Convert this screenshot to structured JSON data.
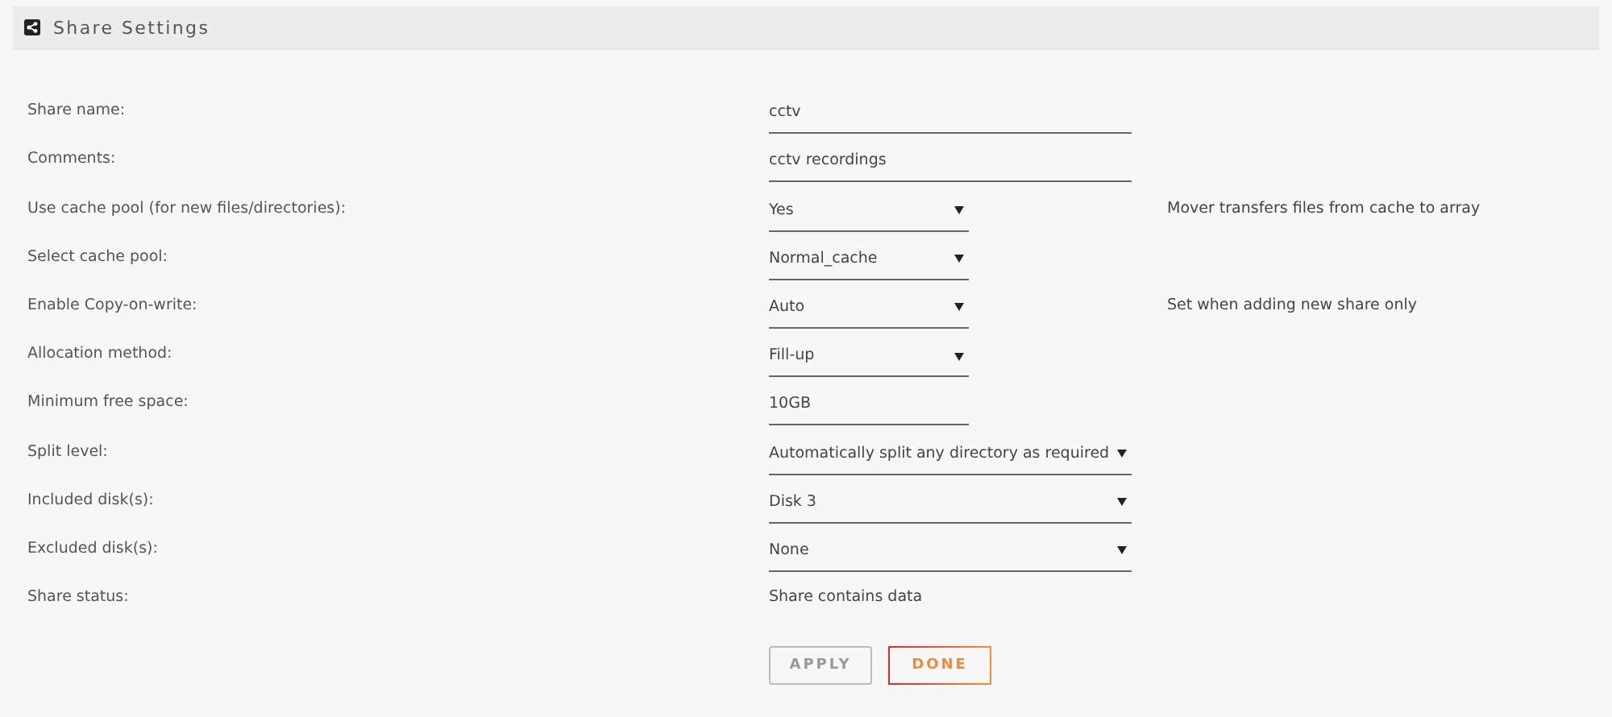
{
  "header": {
    "title": "Share Settings"
  },
  "rows": [
    {
      "label": "Share name:",
      "kind": "input",
      "wide": true,
      "value": "cctv"
    },
    {
      "label": "Comments:",
      "kind": "input",
      "wide": true,
      "value": "cctv recordings"
    },
    {
      "label": "Use cache pool (for new files/directories):",
      "kind": "select",
      "wide": false,
      "value": "Yes",
      "note": "Mover transfers files from cache to array"
    },
    {
      "label": "Select cache pool:",
      "kind": "select",
      "wide": false,
      "value": "Normal_cache"
    },
    {
      "label": "Enable Copy-on-write:",
      "kind": "select",
      "wide": false,
      "value": "Auto",
      "note": "Set when adding new share only"
    },
    {
      "label": "Allocation method:",
      "kind": "select",
      "wide": false,
      "value": "Fill-up"
    },
    {
      "label": "Minimum free space:",
      "kind": "input",
      "wide": false,
      "value": "10GB"
    },
    {
      "label": "Split level:",
      "kind": "select",
      "wide": true,
      "value": "Automatically split any directory as required"
    },
    {
      "label": "Included disk(s):",
      "kind": "select",
      "wide": true,
      "value": "Disk 3"
    },
    {
      "label": "Excluded disk(s):",
      "kind": "select",
      "wide": true,
      "value": "None"
    },
    {
      "label": "Share status:",
      "kind": "static",
      "value": "Share contains data"
    }
  ],
  "buttons": [
    {
      "label": "APPLY",
      "disabled": true
    },
    {
      "label": "DONE",
      "disabled": false
    }
  ]
}
